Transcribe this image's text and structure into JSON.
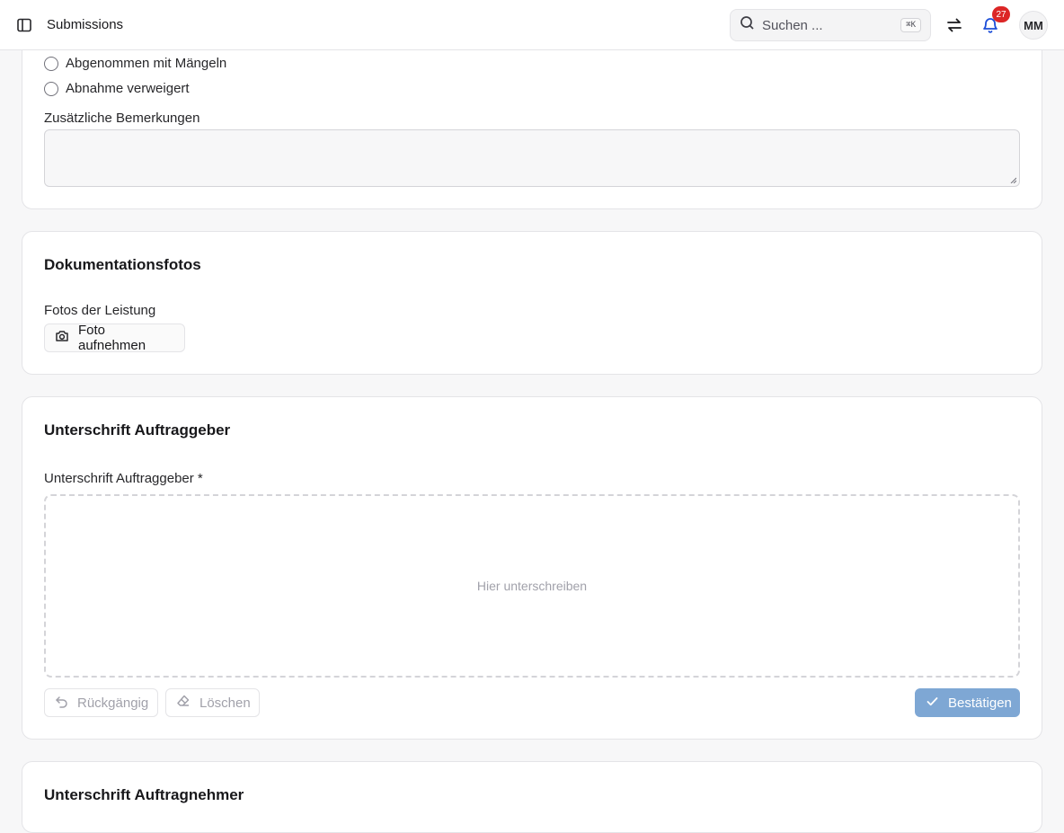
{
  "header": {
    "title": "Submissions",
    "search_placeholder": "Suchen ...",
    "search_shortcut": "⌘K",
    "notification_count": "27",
    "avatar_initials": "MM"
  },
  "acceptance": {
    "options": [
      {
        "label": "Abgenommen mit Mängeln",
        "selected": false
      },
      {
        "label": "Abnahme verweigert",
        "selected": false
      }
    ],
    "remarks_label": "Zusätzliche Bemerkungen",
    "remarks_value": ""
  },
  "photos": {
    "heading": "Dokumentationsfotos",
    "field_label": "Fotos der Leistung",
    "capture_button": "Foto aufnehmen"
  },
  "client_signature": {
    "heading": "Unterschrift Auftraggeber",
    "field_label": "Unterschrift Auftraggeber *",
    "placeholder": "Hier unterschreiben",
    "undo_button": "Rückgängig",
    "clear_button": "Löschen",
    "confirm_button": "Bestätigen"
  },
  "contractor_signature": {
    "heading": "Unterschrift Auftragnehmer"
  },
  "colors": {
    "badge": "#dc2626",
    "primary_disabled": "#7ea7d4",
    "bell": "#1d4ed8"
  }
}
